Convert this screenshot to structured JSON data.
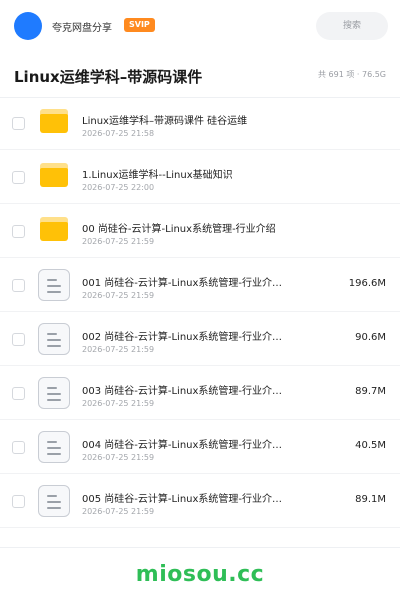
{
  "header": {
    "share_name": "夸克网盘分享",
    "badge": "SVIP",
    "search_placeholder": "搜索",
    "avatar_color": "#1f7bff"
  },
  "title_bar": {
    "title": "Linux运维学科–带源码课件",
    "summary": "共 691 项 · 76.5G"
  },
  "files": [
    {
      "type": "folder",
      "icon": "folder-icon",
      "name": "Linux运维学科–带源码课件 硅谷运维",
      "date": "2026-07-25 21:58",
      "size": ""
    },
    {
      "type": "folder",
      "icon": "folder-icon",
      "name": "1.Linux运维学科--Linux基础知识",
      "date": "2026-07-25 22:00",
      "size": ""
    },
    {
      "type": "folder",
      "icon": "folder-icon",
      "name": "00 尚硅谷-云计算-Linux系统管理-行业介绍",
      "date": "2026-07-25 21:59",
      "size": ""
    },
    {
      "type": "file",
      "icon": "document-icon",
      "name": "001 尚硅谷-云计算-Linux系统管理-行业介…",
      "date": "2026-07-25 21:59",
      "size": "196.6M"
    },
    {
      "type": "file",
      "icon": "document-icon",
      "name": "002 尚硅谷-云计算-Linux系统管理-行业介…",
      "date": "2026-07-25 21:59",
      "size": "90.6M"
    },
    {
      "type": "file",
      "icon": "document-icon",
      "name": "003 尚硅谷-云计算-Linux系统管理-行业介…",
      "date": "2026-07-25 21:59",
      "size": "89.7M"
    },
    {
      "type": "file",
      "icon": "document-icon",
      "name": "004 尚硅谷-云计算-Linux系统管理-行业介…",
      "date": "2026-07-25 21:59",
      "size": "40.5M"
    },
    {
      "type": "file",
      "icon": "document-icon",
      "name": "005 尚硅谷-云计算-Linux系统管理-行业介…",
      "date": "2026-07-25 21:59",
      "size": "89.1M"
    }
  ],
  "footer": {
    "watermark": "miosou.cc",
    "watermark_color": "#2fbe57"
  }
}
